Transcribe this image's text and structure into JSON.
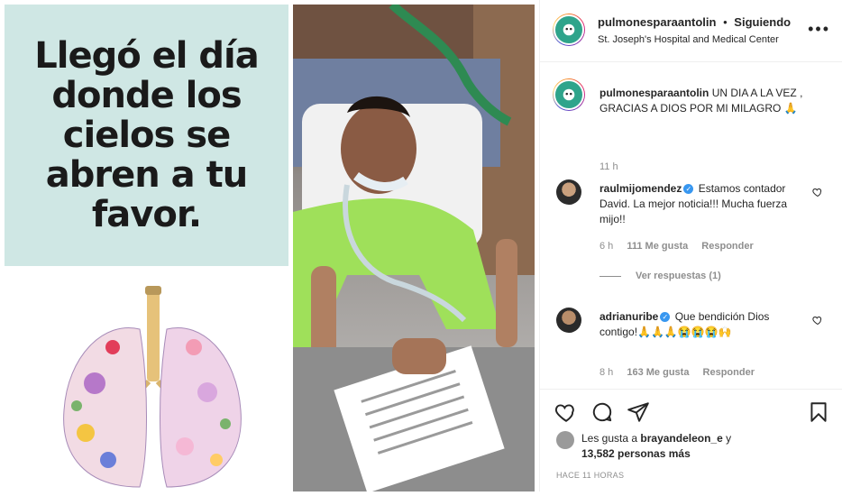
{
  "post": {
    "quote": "Llegó el día donde los cielos se abren a tu favor."
  },
  "header": {
    "username": "pulmonesparaantolin",
    "separator": "•",
    "follow_status": "Siguiendo",
    "location": "St. Joseph's Hospital and Medical Center",
    "more_icon": "more-horizontal-icon"
  },
  "caption": {
    "username": "pulmonesparaantolin",
    "text": "UN DIA A LA VEZ , GRACIAS A DIOS POR MI MILAGRO 🙏",
    "time": "11 h"
  },
  "comments": [
    {
      "username": "raulmijomendez",
      "verified": true,
      "text": "Estamos contador David. La mejor noticia!!! Mucha fuerza mijo!!",
      "time": "6 h",
      "likes": "111 Me gusta",
      "reply": "Responder",
      "view_replies": "Ver respuestas (1)"
    },
    {
      "username": "adrianuribe",
      "verified": true,
      "text": "Que bendición Dios contigo!🙏🙏🙏😭😭😭🙌",
      "time": "8 h",
      "likes": "163 Me gusta",
      "reply": "Responder"
    }
  ],
  "likes": {
    "prefix": "Les gusta a",
    "user": "brayandeleon_e",
    "middle": "y",
    "count": "13,582 personas más"
  },
  "timestamp": "HACE 11 HORAS",
  "colors": {
    "verified": "#3897f0",
    "quote_bg": "#cfe7e4",
    "meta_gray": "#8e8e8e"
  }
}
